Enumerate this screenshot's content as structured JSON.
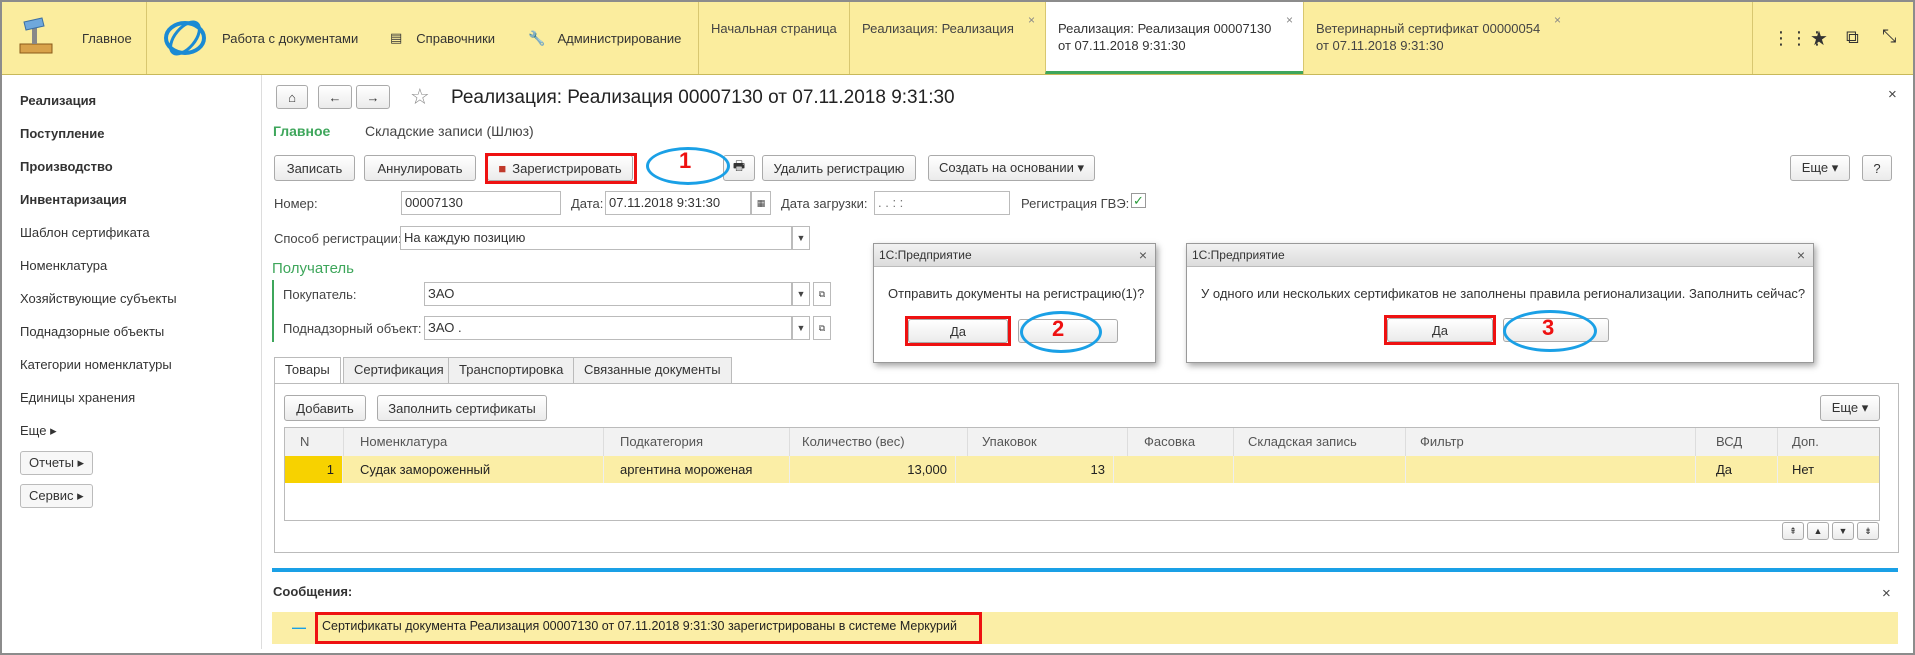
{
  "topbar": {
    "sections": [
      "Главное",
      "Работа с документами",
      "Справочники",
      "Администрирование"
    ],
    "tabs": [
      {
        "line1": "Начальная страница",
        "line2": ""
      },
      {
        "line1": "Реализация: Реализация",
        "line2": ""
      },
      {
        "line1": "Реализация: Реализация 00007130",
        "line2": "от 07.11.2018 9:31:30"
      },
      {
        "line1": "Ветеринарный сертификат 00000054",
        "line2": "от 07.11.2018 9:31:30"
      }
    ],
    "close_glyph": "×"
  },
  "sidebar": {
    "bold_items": [
      "Реализация",
      "Поступление",
      "Производство",
      "Инвентаризация"
    ],
    "items": [
      "Шаблон сертификата",
      "Номенклатура",
      "Хозяйствующие субъекты",
      "Поднадзорные объекты",
      "Категории номенклатуры",
      "Единицы хранения",
      "Еще ▸"
    ],
    "buttons": [
      "Отчеты ▸",
      "Сервис ▸"
    ]
  },
  "form": {
    "title": "Реализация: Реализация 00007130 от 07.11.2018 9:31:30",
    "nav_main": "Главное",
    "nav_wh": "Складские записи (Шлюз)",
    "buttons": {
      "write": "Записать",
      "cancel": "Аннулировать",
      "register": "Зарегистрировать",
      "delete_reg": "Удалить регистрацию",
      "create_based": "Создать на основании ▾",
      "more": "Еще ▾",
      "help": "?"
    },
    "fields": {
      "number_label": "Номер:",
      "number": "00007130",
      "date_label": "Дата:",
      "date": "07.11.2018  9:31:30",
      "load_date_label": "Дата загрузки:",
      "load_date": "  .    .       :    :",
      "gvz_label": "Регистрация ГВЭ:",
      "method_label": "Способ регистрации:",
      "method": "На каждую позицию",
      "recipient_header": "Получатель",
      "buyer_label": "Покупатель:",
      "buyer": "ЗАО",
      "object_label": "Поднадзорный объект:",
      "object": "ЗАО                                                        ."
    },
    "tabs": [
      "Товары",
      "Сертификация",
      "Транспортировка",
      "Связанные документы"
    ],
    "table_buttons": {
      "add": "Добавить",
      "fill": "Заполнить сертификаты",
      "more": "Еще ▾"
    },
    "columns": [
      "N",
      "Номенклатура",
      "Подкатегория",
      "Количество (вес)",
      "Упаковок",
      "Фасовка",
      "Складская запись",
      "Фильтр",
      "ВСД",
      "Доп."
    ],
    "rows": [
      {
        "n": "1",
        "name": "Судак замороженный",
        "sub": "аргентина мороженая",
        "qty": "13,000",
        "packs": "13",
        "fas": "",
        "wh": "",
        "filter": "",
        "vsd": "Да",
        "dop": "Нет"
      }
    ],
    "messages_label": "Сообщения:",
    "message": "Сертификаты документа Реализация 00007130 от 07.11.2018 9:31:30 зарегистрированы в системе Меркурий"
  },
  "dialogs": [
    {
      "title": "1С:Предприятие",
      "text": "Отправить документы на регистрацию(1)?",
      "yes": "Да",
      "no": ""
    },
    {
      "title": "1С:Предприятие",
      "text": "У одного или нескольких сертификатов не заполнены правила регионализации. Заполнить сейчас?",
      "yes": "Да",
      "no": ""
    }
  ],
  "annotations": [
    "1",
    "2",
    "3"
  ],
  "colors": {
    "topbar": "#fbed9e",
    "accent_green": "#3ea65b",
    "highlight": "#fbeea6",
    "red_frame": "#ee1111",
    "blue_oval": "#1aa0e6"
  }
}
